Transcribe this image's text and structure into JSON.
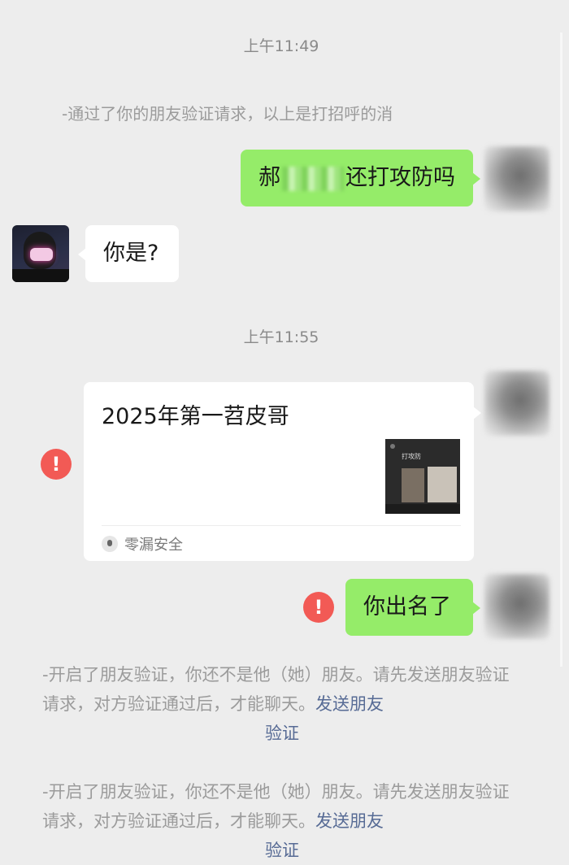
{
  "chat": {
    "timestamps": [
      "上午11:49",
      "上午11:55"
    ],
    "system_note": "-通过了你的朋友验证请求，以上是打招呼的消",
    "messages": [
      {
        "from": "me",
        "text_start": "郝",
        "text_end": "还打攻防吗"
      },
      {
        "from": "other",
        "text": "你是?"
      },
      {
        "from": "me",
        "type": "card",
        "card_title": "2025年第一苕皮哥",
        "thumb_label": "打攻防",
        "card_source": "零漏安全",
        "failed": true
      },
      {
        "from": "me",
        "text": "你出名了",
        "failed": true
      }
    ],
    "failed_icon": "!",
    "notices": [
      {
        "text": "-开启了朋友验证，你还不是他（她）朋友。请先发送朋友验证请求，对方验证通过后，才能聊天。",
        "link_start": "发送朋友",
        "link_end": "验证"
      },
      {
        "text": "-开启了朋友验证，你还不是他（她）朋友。请先发送朋友验证请求，对方验证通过后，才能聊天。",
        "link_start": "发送朋友",
        "link_end": "验证"
      }
    ]
  },
  "colors": {
    "background": "#ededed",
    "my_bubble": "#95ec69",
    "other_bubble": "#ffffff",
    "error": "#f25a55",
    "link": "#576b95",
    "system_text": "#9b9b9b"
  },
  "icons": {
    "avatar_me": "blurred-avatar-icon",
    "avatar_other": "masked-person-avatar-icon",
    "failed": "exclamation-icon",
    "source": "person-dot-icon"
  }
}
